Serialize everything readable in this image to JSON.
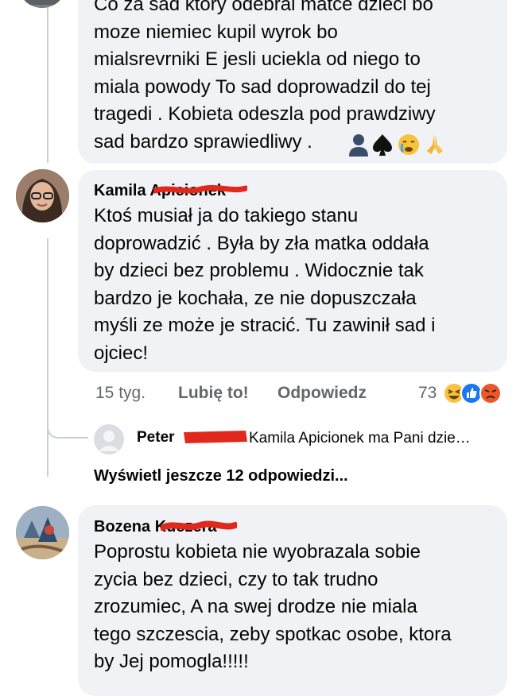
{
  "comment1": {
    "text": "Co za sad ktory odebral matce dzieci  bo\nmoze niemiec kupil wyrok bo\nmialsrevrniki E  jesli uciekla od niego to\nmiala powody To sad doprowadzil do tej\ntragedi .  Kobieta odeszla pod prawdziwy\nsad  bardzo sprawiedliwy ."
  },
  "comment2": {
    "author_first": "Kamila",
    "author_last": "Apicionek",
    "text": "Ktoś musiał ja do takiego stanu\ndoprowadzić . Była by zła matka oddała\nby dzieci bez problemu . Widocznie tak\nbardzo je kochała, ze nie dopuszczała\nmyśli ze może je stracić. Tu zawinił sad i\nojciec!",
    "time": "15 tyg.",
    "like_label": "Lubię to!",
    "reply_label": "Odpowiedz",
    "reaction_count": "73"
  },
  "reply_preview": {
    "author": "Peter",
    "text": "Kamila Apicionek ma Pani dzie…"
  },
  "more_replies": "Wyświetl jeszcze 12 odpowiedzi...",
  "comment3": {
    "author_first": "Bozena",
    "author_last": "Kuczera",
    "text": "Poprostu kobieta nie wyobrazala sobie\nzycia bez dzieci, czy to tak trudno\nzrozumiec, A na swej drodze nie miala\ntego szczescia, zeby spotkac osobe, ktora\nby Jej pomogla!!!!!"
  },
  "colors": {
    "bubble": "#f0f2f5",
    "muted_text": "#65676b",
    "redaction": "#e0281c"
  }
}
